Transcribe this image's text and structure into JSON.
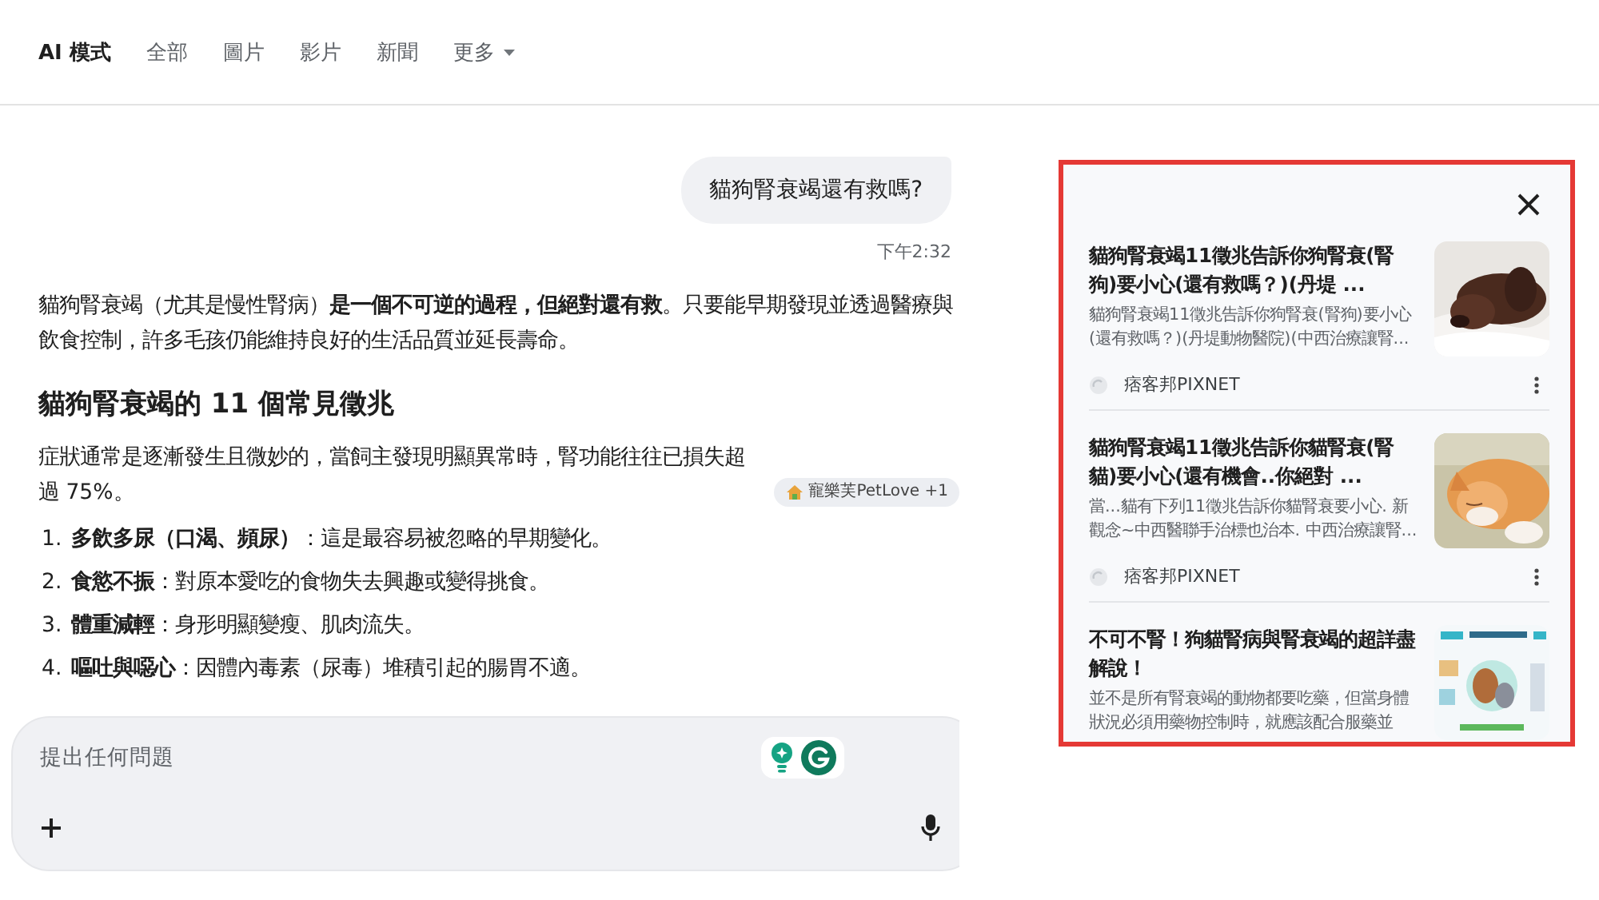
{
  "nav": {
    "tabs": [
      {
        "label": "AI 模式",
        "selected": true
      },
      {
        "label": "全部",
        "selected": false
      },
      {
        "label": "圖片",
        "selected": false
      },
      {
        "label": "影片",
        "selected": false
      },
      {
        "label": "新聞",
        "selected": false
      },
      {
        "label": "更多",
        "selected": false,
        "kind": "dropdown"
      }
    ]
  },
  "chat": {
    "user_message": "貓狗腎衰竭還有救嗎?",
    "time": "下午2:32",
    "intro": "貓狗腎衰竭（尤其是慢性腎病）**是一個不可逆的過程，但絕對還有救**。只要能早期發現並透過醫療與飲食控制，許多毛孩仍能維持良好的生活品質並延長壽命。",
    "heading": "貓狗腎衰竭的 11 個常見徵兆",
    "summary": "症狀通常是逐漸發生且微妙的，當飼主發現明顯異常時，腎功能往往已損失超過 75%。",
    "source_chip": "寵樂芙PetLove +1",
    "list": [
      {
        "number": "1.",
        "text": "**多飲多尿（口渴、頻尿）**：這是最容易被忽略的早期變化。"
      },
      {
        "number": "2.",
        "text": "**食慾不振**：對原本愛吃的食物失去興趣或變得挑食。"
      },
      {
        "number": "3.",
        "text": "**體重減輕**：身形明顯變瘦、肌肉流失。"
      },
      {
        "number": "4.",
        "text": "**嘔吐與噁心**：因體內毒素（尿毒）堆積引起的腸胃不適。"
      }
    ]
  },
  "composer": {
    "placeholder": "提出任何問題"
  },
  "sources_panel": {
    "cards": [
      {
        "title": "貓狗腎衰竭11徵兆告訴你狗腎衰(腎狗)要小心(還有救嗎？)(丹堤 ...",
        "snippet": "貓狗腎衰竭11徵兆告訴你狗腎衰(腎狗)要小心(還有救嗎？)(丹堤動物醫院)(中西治療讓腎...",
        "source": "痞客邦PIXNET",
        "kind": "dog"
      },
      {
        "title": "貓狗腎衰竭11徵兆告訴你貓腎衰(腎貓)要小心(還有機會..你絕對 ...",
        "snippet": "當...貓有下列11徵兆告訴你貓腎衰要小心. 新觀念~中西醫聯手治標也治本. 中西治療讓腎...",
        "source": "痞客邦PIXNET",
        "kind": "cat"
      },
      {
        "title": "不可不腎！狗貓腎病與腎衰竭的超詳盡解說！",
        "snippet": "並不是所有腎衰竭的動物都要吃藥，但當身體狀況必須用藥物控制時，就應該配合服藥並",
        "kind": "infographic"
      }
    ]
  }
}
